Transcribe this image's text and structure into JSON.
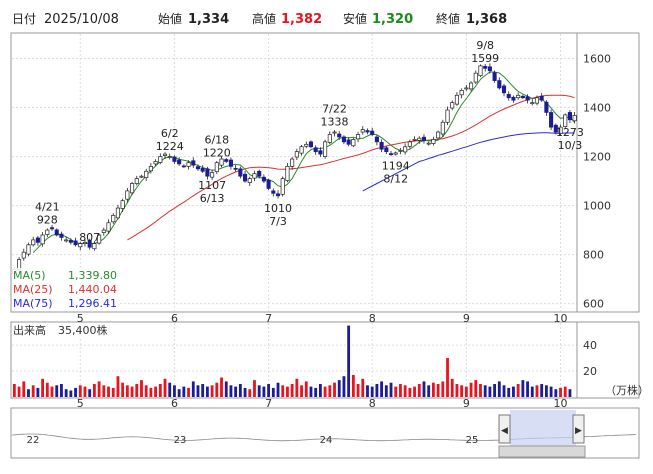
{
  "header": {
    "date_label": "日付",
    "date": "2025/10/08",
    "open_label": "始値",
    "open": "1,334",
    "high_label": "高値",
    "high": "1,382",
    "low_label": "安値",
    "low": "1,320",
    "close_label": "終値",
    "close": "1,368"
  },
  "colors": {
    "high": "#e8141f",
    "low": "#1a8c1a",
    "up_candle": "#ffffff",
    "down_candle": "#1c1c96",
    "ma5": "#2a8a2a",
    "ma25": "#e03030",
    "ma75": "#2a2ae0",
    "vol_up": "#e8141f",
    "vol_down": "#1c1c96"
  },
  "ma_legend": [
    {
      "label": "MA(5)",
      "value": "1,339.80"
    },
    {
      "label": "MA(25)",
      "value": "1,440.04"
    },
    {
      "label": "MA(75)",
      "value": "1,296.41"
    }
  ],
  "volume_legend": {
    "label": "出来高",
    "value": "35,400株"
  },
  "volume_unit": "（万株）",
  "navigator_labels": [
    "22",
    "23",
    "24",
    "25"
  ],
  "chart_data": [
    {
      "type": "candlestick",
      "title": "",
      "y_ticks": [
        600,
        800,
        1000,
        1200,
        1400,
        1600
      ],
      "ylim": [
        570,
        1700
      ],
      "month_ticks": [
        {
          "label": "5",
          "index": 14
        },
        {
          "label": "6",
          "index": 34
        },
        {
          "label": "7",
          "index": 54
        },
        {
          "label": "8",
          "index": 76
        },
        {
          "label": "9",
          "index": 96
        },
        {
          "label": "10",
          "index": 116
        }
      ],
      "annotations": [
        {
          "index": 7,
          "lines": [
            "4/21",
            "928"
          ],
          "position": "above"
        },
        {
          "index": 16,
          "lines": [
            "807"
          ],
          "position": "above"
        },
        {
          "index": 33,
          "lines": [
            "6/2",
            "1224"
          ],
          "position": "above"
        },
        {
          "index": 43,
          "lines": [
            "6/18",
            "1220"
          ],
          "position": "above"
        },
        {
          "index": 42,
          "lines": [
            "1107",
            "6/13"
          ],
          "position": "below"
        },
        {
          "index": 56,
          "lines": [
            "1010",
            "7/3"
          ],
          "position": "below"
        },
        {
          "index": 68,
          "lines": [
            "7/22",
            "1338"
          ],
          "position": "above"
        },
        {
          "index": 81,
          "lines": [
            "1194",
            "8/12"
          ],
          "position": "below"
        },
        {
          "index": 100,
          "lines": [
            "9/8",
            "1599"
          ],
          "position": "above"
        },
        {
          "index": 118,
          "lines": [
            "1273",
            "10/3"
          ],
          "position": "below"
        }
      ],
      "close": [
        740,
        780,
        810,
        840,
        860,
        850,
        880,
        900,
        905,
        880,
        870,
        860,
        850,
        840,
        845,
        850,
        830,
        845,
        880,
        900,
        930,
        960,
        990,
        1020,
        1060,
        1090,
        1110,
        1120,
        1140,
        1160,
        1180,
        1200,
        1210,
        1200,
        1180,
        1170,
        1160,
        1175,
        1165,
        1150,
        1140,
        1120,
        1135,
        1175,
        1190,
        1180,
        1160,
        1150,
        1120,
        1100,
        1110,
        1130,
        1120,
        1100,
        1070,
        1050,
        1040,
        1110,
        1160,
        1190,
        1220,
        1240,
        1250,
        1240,
        1220,
        1210,
        1260,
        1290,
        1300,
        1280,
        1260,
        1250,
        1270,
        1290,
        1310,
        1300,
        1290,
        1260,
        1230,
        1220,
        1210,
        1215,
        1225,
        1240,
        1260,
        1270,
        1275,
        1265,
        1255,
        1270,
        1300,
        1340,
        1390,
        1420,
        1450,
        1470,
        1480,
        1500,
        1540,
        1570,
        1560,
        1550,
        1510,
        1480,
        1460,
        1440,
        1430,
        1450,
        1440,
        1430,
        1420,
        1440,
        1430,
        1380,
        1320,
        1300,
        1320,
        1370,
        1350,
        1368
      ],
      "ma5": [
        null,
        null,
        null,
        null,
        808,
        828,
        848,
        866,
        879,
        883,
        881,
        873,
        861,
        849,
        845,
        847,
        845,
        846,
        852,
        865,
        887,
        917,
        946,
        980,
        1012,
        1046,
        1074,
        1100,
        1121,
        1143,
        1162,
        1180,
        1194,
        1200,
        1198,
        1189,
        1185,
        1181,
        1172,
        1163,
        1155,
        1150,
        1144,
        1146,
        1153,
        1160,
        1164,
        1169,
        1165,
        1148,
        1126,
        1118,
        1116,
        1110,
        1105,
        1098,
        1081,
        1075,
        1087,
        1110,
        1145,
        1181,
        1212,
        1228,
        1235,
        1233,
        1236,
        1246,
        1260,
        1274,
        1278,
        1276,
        1279,
        1275,
        1274,
        1284,
        1292,
        1289,
        1277,
        1262,
        1246,
        1233,
        1225,
        1224,
        1230,
        1244,
        1259,
        1265,
        1265,
        1263,
        1267,
        1281,
        1307,
        1342,
        1380,
        1412,
        1437,
        1463,
        1488,
        1515,
        1531,
        1545,
        1545,
        1541,
        1526,
        1505,
        1484,
        1466,
        1455,
        1446,
        1437,
        1437,
        1433,
        1420,
        1398,
        1374,
        1356,
        1358,
        1361,
        1339.8
      ],
      "ma25": [
        null,
        null,
        null,
        null,
        null,
        null,
        null,
        null,
        null,
        null,
        null,
        null,
        null,
        null,
        null,
        null,
        null,
        null,
        null,
        null,
        null,
        null,
        null,
        null,
        860,
        871,
        883,
        895,
        907,
        920,
        934,
        949,
        963,
        977,
        989,
        1002,
        1014,
        1027,
        1040,
        1052,
        1064,
        1075,
        1087,
        1099,
        1110,
        1120,
        1129,
        1137,
        1144,
        1150,
        1154,
        1156,
        1157,
        1156,
        1154,
        1152,
        1149,
        1148,
        1149,
        1150,
        1152,
        1155,
        1158,
        1161,
        1164,
        1167,
        1171,
        1176,
        1181,
        1187,
        1192,
        1197,
        1202,
        1207,
        1213,
        1220,
        1227,
        1233,
        1238,
        1243,
        1247,
        1251,
        1255,
        1258,
        1261,
        1263,
        1265,
        1266,
        1267,
        1268,
        1270,
        1273,
        1278,
        1284,
        1291,
        1299,
        1308,
        1318,
        1329,
        1341,
        1353,
        1365,
        1375,
        1385,
        1394,
        1402,
        1410,
        1418,
        1425,
        1432,
        1438,
        1443,
        1447,
        1449,
        1450,
        1450,
        1450,
        1449,
        1446,
        1440.04
      ],
      "ma75": [
        null,
        null,
        null,
        null,
        null,
        null,
        null,
        null,
        null,
        null,
        null,
        null,
        null,
        null,
        null,
        null,
        null,
        null,
        null,
        null,
        null,
        null,
        null,
        null,
        null,
        null,
        null,
        null,
        null,
        null,
        null,
        null,
        null,
        null,
        null,
        null,
        null,
        null,
        null,
        null,
        null,
        null,
        null,
        null,
        null,
        null,
        null,
        null,
        null,
        null,
        null,
        null,
        null,
        null,
        null,
        null,
        null,
        null,
        null,
        null,
        null,
        null,
        null,
        null,
        null,
        null,
        null,
        null,
        null,
        null,
        null,
        null,
        null,
        null,
        1060,
        1070,
        1080,
        1090,
        1100,
        1110,
        1120,
        1130,
        1140,
        1150,
        1160,
        1170,
        1180,
        1185,
        1192,
        1198,
        1205,
        1210,
        1216,
        1222,
        1228,
        1234,
        1240,
        1246,
        1252,
        1258,
        1263,
        1268,
        1272,
        1276,
        1280,
        1284,
        1287,
        1290,
        1292,
        1294,
        1295,
        1296,
        1297,
        1297,
        1296,
        1295,
        1295,
        1296,
        1296,
        1296.41
      ]
    },
    {
      "type": "bar",
      "title": "",
      "ylabel": "（万株）",
      "y_ticks": [
        20,
        40
      ],
      "ylim": [
        0,
        57
      ],
      "values": [
        10,
        8,
        12,
        6,
        9,
        7,
        14,
        11,
        8,
        9,
        10,
        6,
        5,
        7,
        9,
        8,
        6,
        10,
        12,
        9,
        8,
        7,
        16,
        11,
        9,
        8,
        10,
        13,
        9,
        7,
        8,
        10,
        14,
        11,
        9,
        6,
        8,
        7,
        12,
        9,
        10,
        8,
        9,
        11,
        15,
        12,
        9,
        8,
        10,
        7,
        6,
        13,
        9,
        8,
        10,
        7,
        11,
        9,
        8,
        10,
        14,
        9,
        12,
        8,
        7,
        10,
        8,
        9,
        11,
        13,
        16,
        55,
        17,
        10,
        14,
        9,
        8,
        10,
        12,
        9,
        11,
        8,
        10,
        9,
        7,
        8,
        10,
        12,
        9,
        11,
        10,
        12,
        30,
        14,
        10,
        9,
        8,
        11,
        13,
        10,
        9,
        8,
        10,
        12,
        9,
        7,
        8,
        10,
        13,
        12,
        8,
        9,
        10,
        9,
        8,
        6,
        7,
        8,
        6
      ],
      "up": [
        1,
        1,
        1,
        0,
        1,
        0,
        1,
        1,
        1,
        0,
        0,
        0,
        0,
        0,
        1,
        1,
        0,
        1,
        1,
        1,
        1,
        1,
        1,
        1,
        1,
        1,
        1,
        1,
        1,
        1,
        1,
        1,
        1,
        0,
        0,
        0,
        0,
        1,
        0,
        0,
        0,
        0,
        1,
        1,
        1,
        0,
        0,
        0,
        0,
        0,
        1,
        1,
        0,
        0,
        0,
        0,
        0,
        1,
        1,
        1,
        1,
        1,
        1,
        0,
        0,
        0,
        1,
        1,
        1,
        0,
        0,
        0,
        1,
        1,
        1,
        0,
        0,
        0,
        0,
        0,
        0,
        1,
        1,
        1,
        1,
        1,
        1,
        0,
        0,
        1,
        1,
        1,
        1,
        1,
        1,
        1,
        1,
        1,
        1,
        1,
        0,
        0,
        0,
        0,
        0,
        0,
        0,
        1,
        0,
        0,
        0,
        1,
        0,
        0,
        0,
        0,
        1,
        1,
        0,
        1
      ]
    }
  ]
}
